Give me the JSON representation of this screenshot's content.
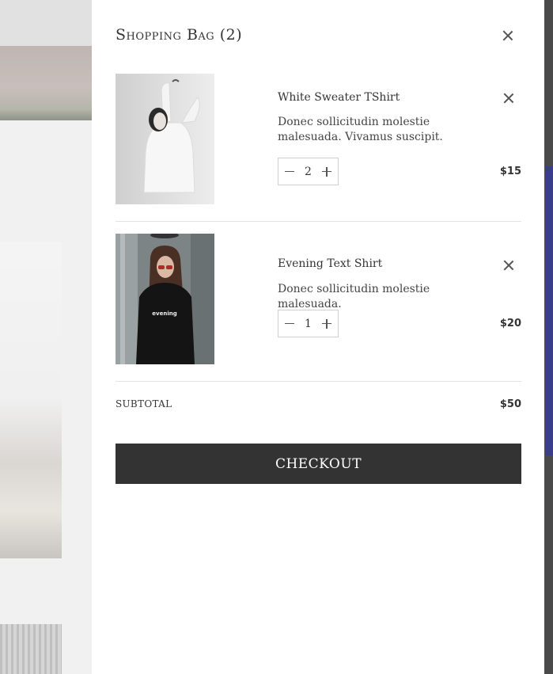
{
  "cart": {
    "title": "Shopping Bag (2)",
    "items": [
      {
        "name": "White Sweater TShirt",
        "description": "Donec sollicitudin molestie malesuada. Vivamus suscipit.",
        "quantity": "2",
        "price": "$15",
        "image_icon": "product-image-white-sweater"
      },
      {
        "name": "Evening Text Shirt",
        "description": "Donec sollicitudin molestie malesuada.",
        "quantity": "1",
        "price": "$20",
        "image_icon": "product-image-evening-shirt",
        "shirt_print": "evening"
      }
    ],
    "subtotal_label": "SUBTOTAL",
    "subtotal_value": "$50",
    "checkout_label": "CHECKOUT"
  },
  "colors": {
    "checkout_bg": "#333333",
    "accent_strip": "#3a3d8a"
  }
}
